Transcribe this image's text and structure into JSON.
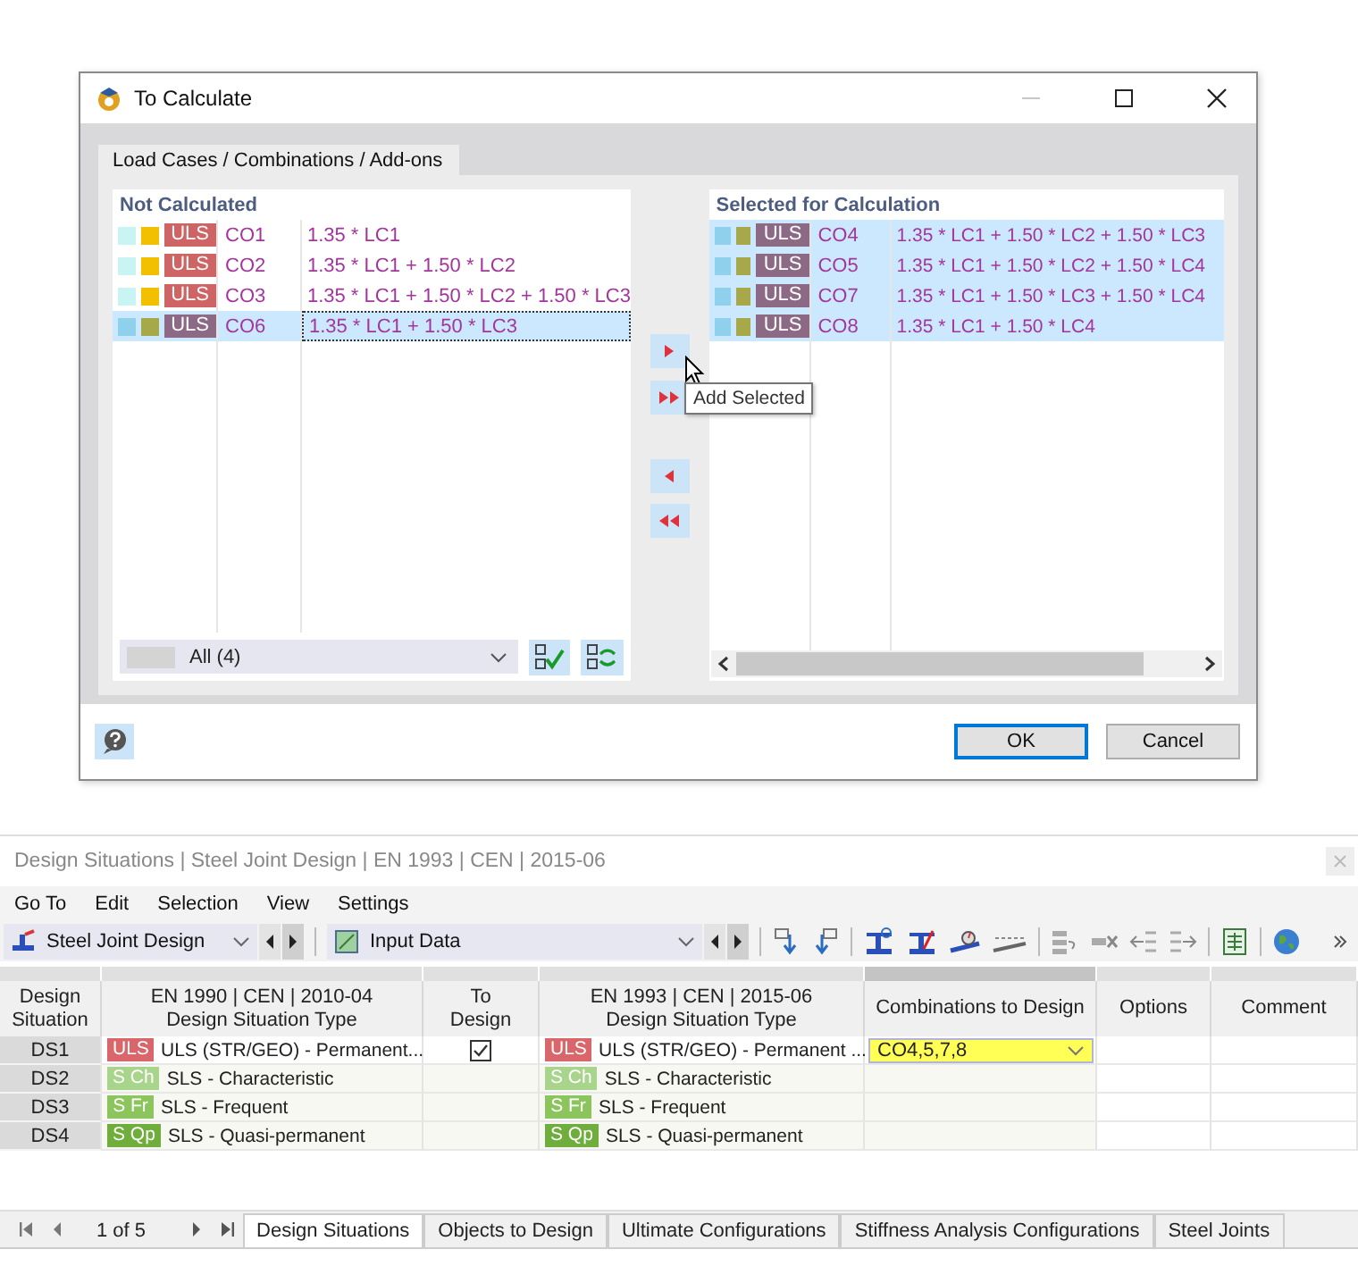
{
  "dialog": {
    "title": "To Calculate",
    "tab": "Load Cases / Combinations / Add-ons",
    "not_calculated": {
      "title": "Not Calculated",
      "filter": "All (4)",
      "rows": [
        {
          "type": "ULS",
          "name": "CO1",
          "formula": "1.35 * LC1",
          "selected": false
        },
        {
          "type": "ULS",
          "name": "CO2",
          "formula": "1.35 * LC1 + 1.50 * LC2",
          "selected": false
        },
        {
          "type": "ULS",
          "name": "CO3",
          "formula": "1.35 * LC1 + 1.50 * LC2 + 1.50 * LC3",
          "selected": false
        },
        {
          "type": "ULS",
          "name": "CO6",
          "formula": "1.35 * LC1 + 1.50 * LC3",
          "selected": true
        }
      ]
    },
    "transfer_buttons": [
      {
        "kind": "add"
      },
      {
        "kind": "add_all"
      },
      {
        "kind": "remove"
      },
      {
        "kind": "remove_all"
      }
    ],
    "tooltip": "Add Selected",
    "selected_for_calculation": {
      "title": "Selected for Calculation",
      "rows": [
        {
          "type": "ULS",
          "name": "CO4",
          "formula": "1.35 * LC1 + 1.50 * LC2 + 1.50 * LC3",
          "selected": true
        },
        {
          "type": "ULS",
          "name": "CO5",
          "formula": "1.35 * LC1 + 1.50 * LC2 + 1.50 * LC4",
          "selected": true
        },
        {
          "type": "ULS",
          "name": "CO7",
          "formula": "1.35 * LC1 + 1.50 * LC3 + 1.50 * LC4",
          "selected": true
        },
        {
          "type": "ULS",
          "name": "CO8",
          "formula": "1.35 * LC1 + 1.50 * LC4",
          "selected": true
        }
      ]
    },
    "buttons": [
      {
        "label": "OK",
        "default": true
      },
      {
        "label": "Cancel",
        "default": false
      }
    ]
  },
  "design_panel": {
    "title": "Design Situations | Steel Joint Design | EN 1993 | CEN | 2015-06",
    "menu": [
      "Go To",
      "Edit",
      "Selection",
      "View",
      "Settings"
    ],
    "module": "Steel Joint Design",
    "view": "Input Data",
    "table": {
      "columns": [
        {
          "lines": [
            "Design",
            "Situation"
          ]
        },
        {
          "lines": [
            "EN 1990 | CEN | 2010-04",
            "Design Situation Type"
          ]
        },
        {
          "lines": [
            "To",
            "Design"
          ]
        },
        {
          "lines": [
            "EN 1993 | CEN | 2015-06",
            "Design Situation Type"
          ]
        },
        {
          "lines": [
            "Combinations to Design"
          ]
        },
        {
          "lines": [
            "Options"
          ]
        },
        {
          "lines": [
            "Comment"
          ]
        }
      ],
      "rows": [
        {
          "id": "DS1",
          "en1990": {
            "badge": "ULS",
            "color": "#d9666a",
            "text": "ULS (STR/GEO) - Permanent..."
          },
          "to_design": {
            "checked": true
          },
          "en1993": {
            "badge": "ULS",
            "color": "#d9666a",
            "text": "ULS (STR/GEO) - Permanent ..."
          },
          "combinations": "CO4,5,7,8"
        },
        {
          "id": "DS2",
          "en1990": {
            "badge": "S Ch",
            "color": "#a9d48c",
            "text": "SLS - Characteristic"
          },
          "en1993": {
            "badge": "S Ch",
            "color": "#a9d48c",
            "text": "SLS - Characteristic"
          }
        },
        {
          "id": "DS3",
          "en1990": {
            "badge": "S Fr",
            "color": "#8cc45e",
            "text": "SLS - Frequent"
          },
          "en1993": {
            "badge": "S Fr",
            "color": "#8cc45e",
            "text": "SLS - Frequent"
          }
        },
        {
          "id": "DS4",
          "en1990": {
            "badge": "S Qp",
            "color": "#6fae3c",
            "text": "SLS - Quasi-permanent"
          },
          "en1993": {
            "badge": "S Qp",
            "color": "#6fae3c",
            "text": "SLS - Quasi-permanent"
          }
        }
      ]
    },
    "pager": "1 of 5",
    "tabs": [
      {
        "label": "Design Situations",
        "selected": true
      },
      {
        "label": "Objects to Design",
        "selected": false
      },
      {
        "label": "Ultimate Configurations",
        "selected": false
      },
      {
        "label": "Stiffness Analysis Configurations",
        "selected": false
      },
      {
        "label": "Steel Joints",
        "selected": false
      }
    ]
  }
}
